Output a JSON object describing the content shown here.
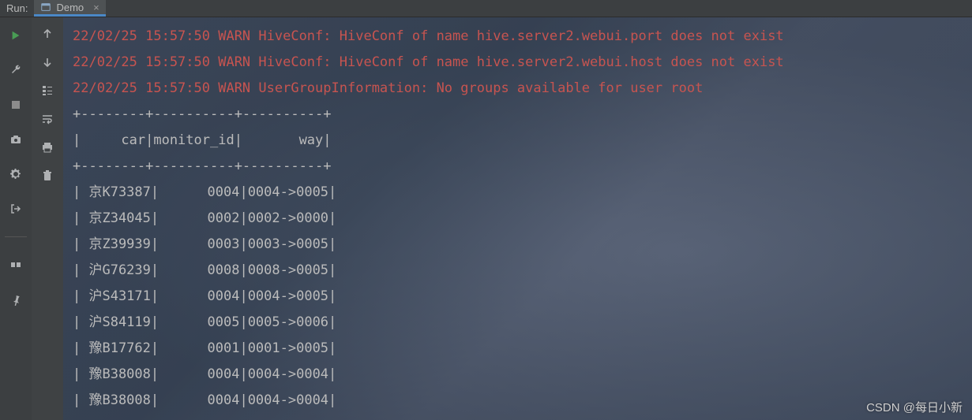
{
  "header": {
    "run_label": "Run:",
    "tab_label": "Demo",
    "tab_close": "×"
  },
  "icons": {
    "play": "play-icon",
    "wrench": "wrench-icon",
    "stop": "stop-icon",
    "camera": "camera-icon",
    "gear": "gear-icon",
    "exit": "exit-icon",
    "layout": "layout-icon",
    "pin": "pin-icon",
    "up": "arrow-up-icon",
    "down": "arrow-down-icon",
    "tree": "tree-icon",
    "wrap": "wrap-icon",
    "print": "print-icon",
    "trash": "trash-icon"
  },
  "console": {
    "warn_lines": [
      "22/02/25 15:57:50 WARN HiveConf: HiveConf of name hive.server2.webui.port does not exist",
      "22/02/25 15:57:50 WARN HiveConf: HiveConf of name hive.server2.webui.host does not exist",
      "22/02/25 15:57:50 WARN UserGroupInformation: No groups available for user root"
    ],
    "table_border": "+--------+----------+----------+",
    "table_header": "|     car|monitor_id|       way|"
  },
  "chart_data": {
    "type": "table",
    "columns": [
      "car",
      "monitor_id",
      "way"
    ],
    "rows": [
      {
        "car": "京K73387",
        "monitor_id": "0004",
        "way": "0004->0005"
      },
      {
        "car": "京Z34045",
        "monitor_id": "0002",
        "way": "0002->0000"
      },
      {
        "car": "京Z39939",
        "monitor_id": "0003",
        "way": "0003->0005"
      },
      {
        "car": "沪G76239",
        "monitor_id": "0008",
        "way": "0008->0005"
      },
      {
        "car": "沪S43171",
        "monitor_id": "0004",
        "way": "0004->0005"
      },
      {
        "car": "沪S84119",
        "monitor_id": "0005",
        "way": "0005->0006"
      },
      {
        "car": "豫B17762",
        "monitor_id": "0001",
        "way": "0001->0005"
      },
      {
        "car": "豫B38008",
        "monitor_id": "0004",
        "way": "0004->0004"
      },
      {
        "car": "豫B38008",
        "monitor_id": "0004",
        "way": "0004->0004"
      }
    ]
  },
  "watermark": "CSDN @每日小新"
}
